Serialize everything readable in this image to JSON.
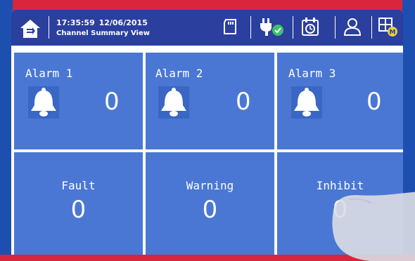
{
  "header": {
    "time": "17:35:59",
    "date": "12/06/2015",
    "title": "Channel Summary View"
  },
  "alarms": [
    {
      "label": "Alarm 1",
      "count": "0"
    },
    {
      "label": "Alarm 2",
      "count": "0"
    },
    {
      "label": "Alarm 3",
      "count": "0"
    }
  ],
  "status": [
    {
      "label": "Fault",
      "count": "0"
    },
    {
      "label": "Warning",
      "count": "0"
    },
    {
      "label": "Inhibit",
      "count": "0"
    }
  ],
  "icons": {
    "home": "home-icon",
    "sd_card": "sd-card-icon",
    "power": "power-plug-icon",
    "schedule": "calendar-clock-icon",
    "user": "user-icon",
    "layout": "layout-grid-icon"
  },
  "colors": {
    "bezel_red": "#d7263d",
    "header_blue": "#2b3f9e",
    "tile_blue": "#4a77d4",
    "ok_green": "#3ec16a",
    "badge_yellow": "#e8d23a"
  }
}
